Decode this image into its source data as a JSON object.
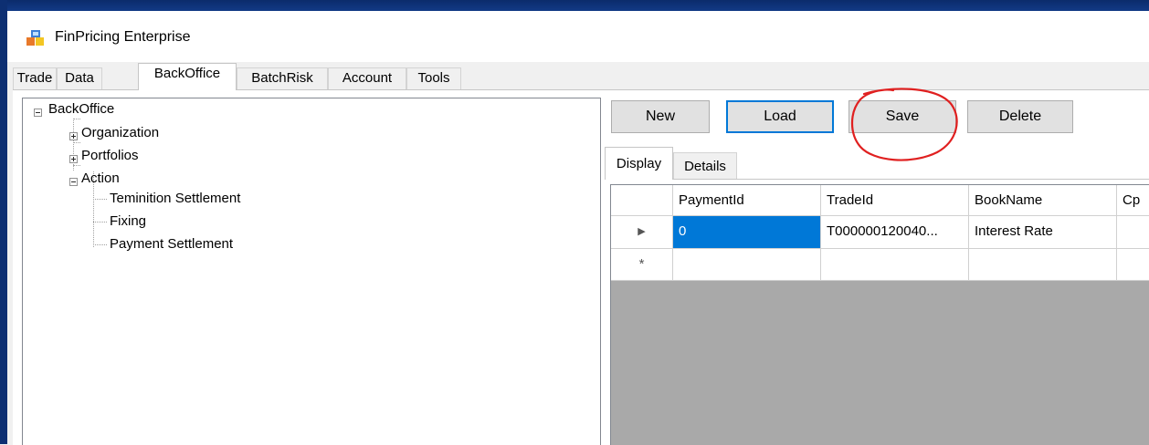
{
  "window": {
    "title": "FinPricing Enterprise"
  },
  "main_tabs": [
    {
      "label": "Trade"
    },
    {
      "label": "Data"
    },
    {
      "label": "BackOffice",
      "active": true
    },
    {
      "label": "BatchRisk"
    },
    {
      "label": "Account"
    },
    {
      "label": "Tools"
    }
  ],
  "tree": {
    "root": "BackOffice",
    "organization": "Organization",
    "portfolios": "Portfolios",
    "action": "Action",
    "action_children": [
      "Teminition Settlement",
      "Fixing",
      "Payment Settlement"
    ]
  },
  "toolbar": {
    "new_label": "New",
    "load_label": "Load",
    "save_label": "Save",
    "delete_label": "Delete"
  },
  "sub_tabs": [
    {
      "label": "Display",
      "active": true
    },
    {
      "label": "Details"
    }
  ],
  "grid": {
    "columns": [
      "PaymentId",
      "TradeId",
      "BookName",
      "Cp"
    ],
    "rows": [
      {
        "PaymentId": "0",
        "TradeId": "T000000120040...",
        "BookName": "Interest Rate",
        "Cp": ""
      }
    ],
    "current_row_marker": "▶",
    "new_row_marker": "*"
  },
  "colors": {
    "annotation": "#e02020",
    "selection": "#0078d7",
    "grid_background": "#a9a9a9"
  }
}
